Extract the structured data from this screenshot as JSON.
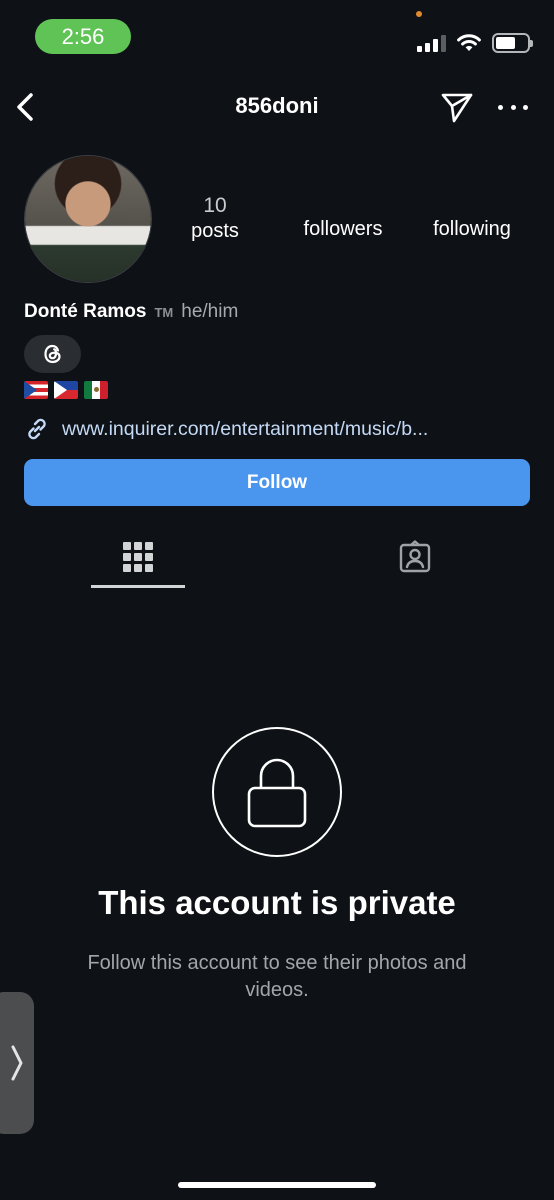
{
  "status_bar": {
    "time": "2:56",
    "time_pill_color": "#5fc356",
    "icons": [
      "signal-icon",
      "wifi-icon",
      "battery-icon"
    ]
  },
  "header": {
    "username": "856doni",
    "back_icon": "chevron-left-icon",
    "send_icon": "send-icon",
    "more_icon": "more-horizontal-icon"
  },
  "profile": {
    "stats": {
      "posts_count": "10",
      "posts_label": "posts",
      "followers_label": "followers",
      "following_label": "following"
    },
    "display_name": "Donté Ramos",
    "trademark": "TM",
    "pronouns": "he/him",
    "threads_badge_icon": "threads-icon",
    "flags": [
      "🇵🇷",
      "🇵🇭",
      "🇲🇽"
    ],
    "link": "www.inquirer.com/entertainment/music/b..."
  },
  "actions": {
    "follow_label": "Follow",
    "follow_color": "#4a96ee"
  },
  "tabs": [
    {
      "name": "posts-grid",
      "icon": "grid-icon",
      "active": true
    },
    {
      "name": "tagged",
      "icon": "tagged-user-icon",
      "active": false
    }
  ],
  "private_notice": {
    "title": "This account is private",
    "subtitle": "Follow this account to see their photos and videos."
  },
  "side_handle": {
    "icon": "chevron-right-icon"
  }
}
